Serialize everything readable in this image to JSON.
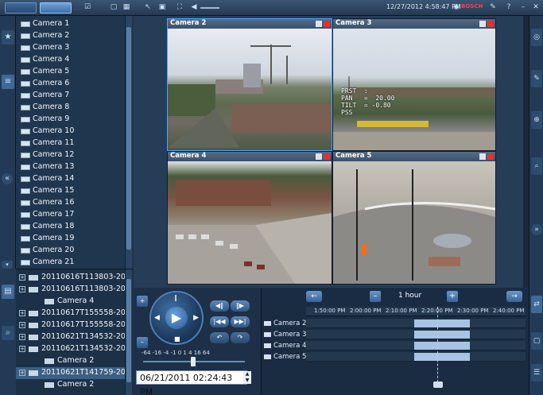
{
  "topbar": {
    "datetime": "12/27/2012 4:58:47 PM",
    "brand": "BOSCH"
  },
  "camera_list": [
    "Camera 1",
    "Camera 2",
    "Camera 3",
    "Camera 4",
    "Camera 5",
    "Camera 6",
    "Camera 7",
    "Camera 8",
    "Camera 9",
    "Camera 10",
    "Camera 11",
    "Camera 12",
    "Camera 13",
    "Camera 14",
    "Camera 15",
    "Camera 16",
    "Camera 17",
    "Camera 18",
    "Camera 19",
    "Camera 20",
    "Camera 21"
  ],
  "recordings": [
    {
      "label": "20110616T113803-20",
      "type": "folder"
    },
    {
      "label": "20110616T113803-20",
      "type": "folder"
    },
    {
      "label": "Camera 4",
      "type": "camera"
    },
    {
      "label": "20110617T155558-20",
      "type": "folder"
    },
    {
      "label": "20110617T155558-20",
      "type": "folder"
    },
    {
      "label": "20110621T134532-20",
      "type": "folder"
    },
    {
      "label": "20110621T134532-20",
      "type": "folder"
    },
    {
      "label": "Camera 2",
      "type": "camera"
    },
    {
      "label": "20110621T141759-20",
      "type": "folder",
      "selected": true
    },
    {
      "label": "Camera 2",
      "type": "camera"
    }
  ],
  "tiles": [
    {
      "title": "Camera 2",
      "active": true
    },
    {
      "title": "Camera 3",
      "osd": "PRST  :\nPAN   =  20.00\nTILT  = -0.80\nPSS"
    },
    {
      "title": "Camera 4"
    },
    {
      "title": "Camera 5"
    }
  ],
  "playback": {
    "speed_scale": "-64 -16  -4  -1  0  1   4   16  64",
    "datetime": "06/21/2011 02:24:43 PM"
  },
  "timeline": {
    "interval": "1 hour",
    "ticks": [
      "1:50:00 PM",
      "2:00:00 PM",
      "2:10:00 PM",
      "2:20:00 PM",
      "2:30:00 PM",
      "2:40:00 PM"
    ],
    "tracks": [
      {
        "name": "Camera 2"
      },
      {
        "name": "Camera 3"
      },
      {
        "name": "Camera 4"
      },
      {
        "name": "Camera 5"
      }
    ]
  },
  "colors": {
    "accent": "#4fa3ff",
    "panel": "#20364f",
    "recording": "#a8c4e2"
  }
}
